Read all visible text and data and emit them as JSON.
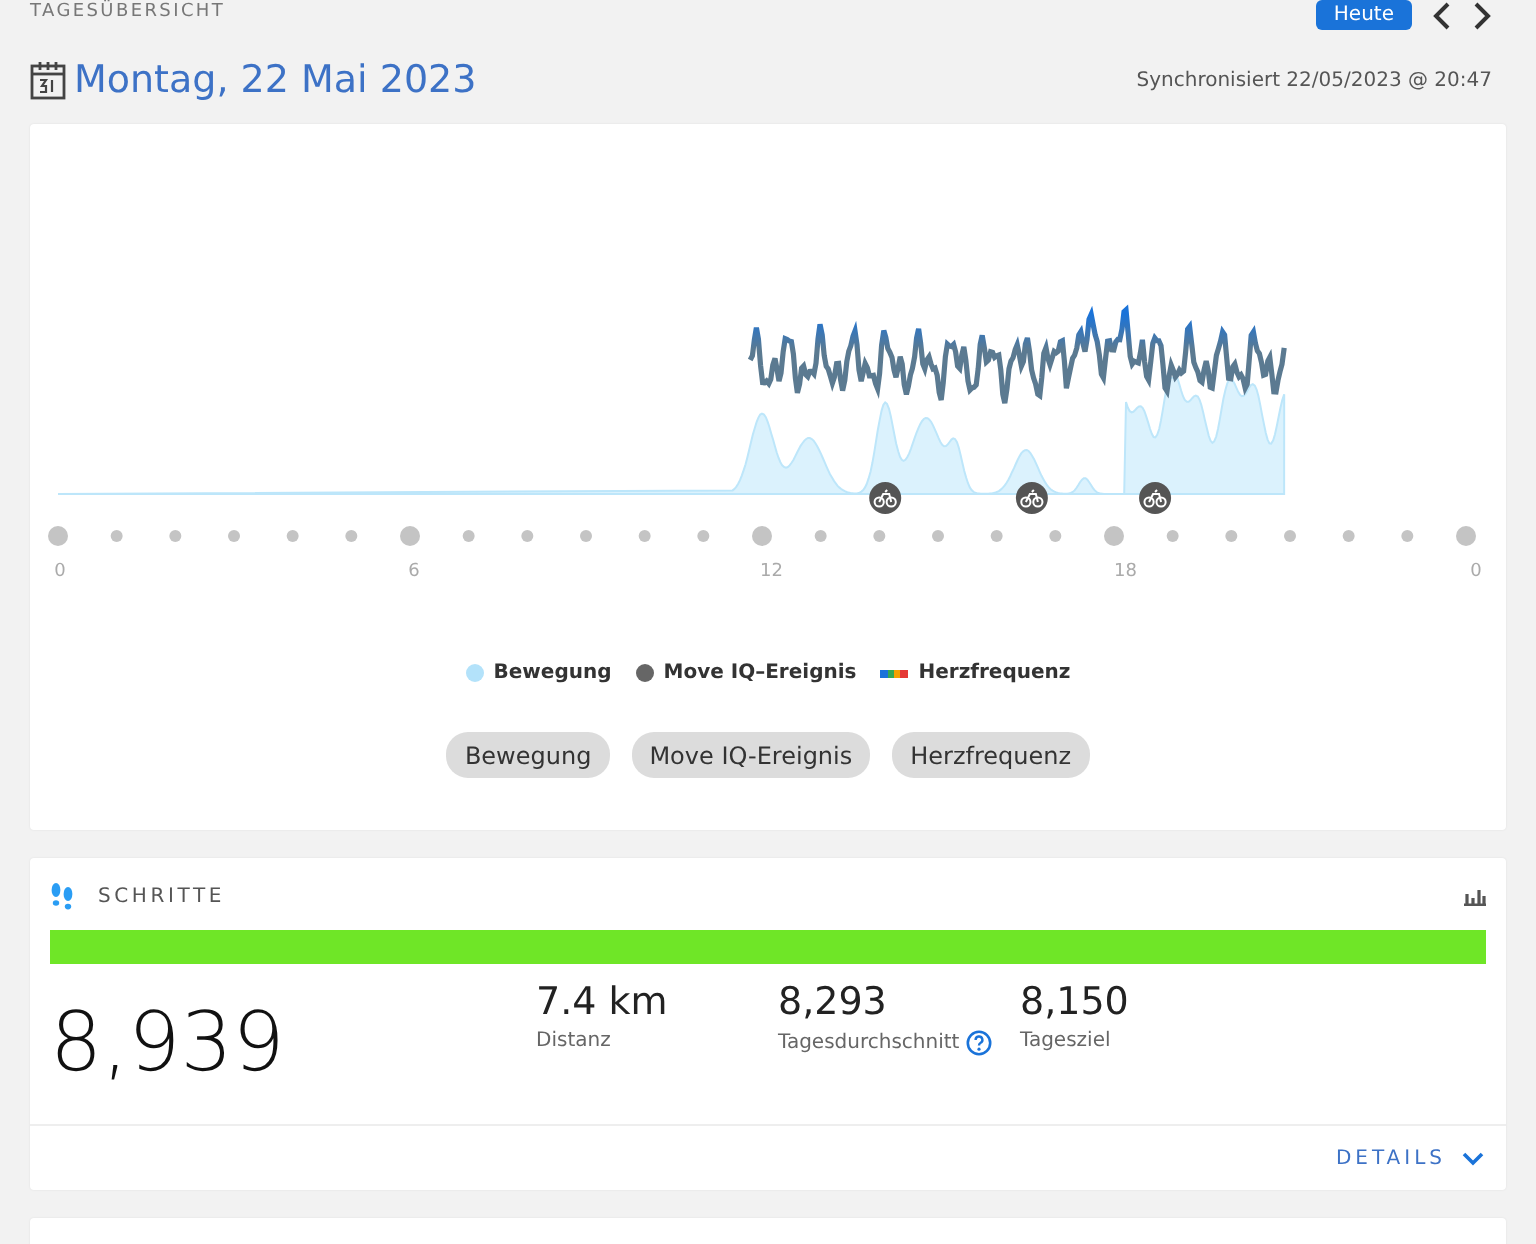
{
  "page_title": "TAGESÜBERSICHT",
  "today_button": "Heute",
  "date": "Montag, 22 Mai 2023",
  "sync": "Synchronisiert 22/05/2023 @ 20:47",
  "timeline": {
    "axis_labels": [
      "0",
      "6",
      "12",
      "18",
      "0"
    ],
    "legend": [
      {
        "kind": "dot",
        "label": "Bewegung",
        "color": "#b3e2fa"
      },
      {
        "kind": "dot",
        "label": "Move IQ–Ereignis",
        "color": "#666666"
      },
      {
        "kind": "gradient",
        "label": "Herzfrequenz"
      }
    ],
    "filters": [
      "Bewegung",
      "Move IQ-Ereignis",
      "Herzfrequenz"
    ]
  },
  "steps": {
    "title": "SCHRITTE",
    "level": 1,
    "total": "8,939",
    "stats": [
      {
        "value": "7.4 km",
        "label": "Distanz",
        "help": false
      },
      {
        "value": "8,293",
        "label": "Tagesdurchschnitt",
        "help": true
      },
      {
        "value": "8,150",
        "label": "Tagesziel",
        "help": false
      }
    ],
    "details": "DETAILS"
  }
}
